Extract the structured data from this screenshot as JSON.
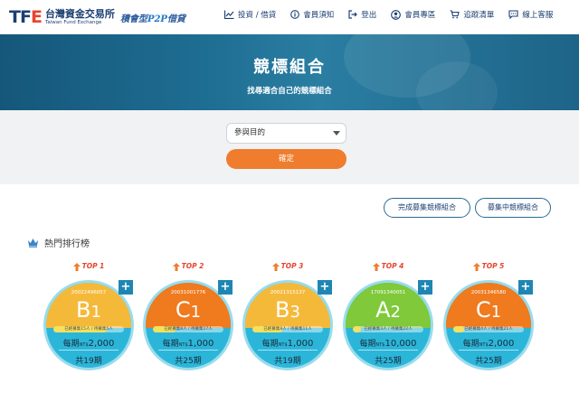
{
  "brand": {
    "mark_prefix": "TF",
    "mark_suffix": "E",
    "name_zh": "台灣資金交易所",
    "name_en": "Taiwan Fund Exchange",
    "slogan_a": "積會型",
    "slogan_p2p": "P2P",
    "slogan_b": "借貸"
  },
  "nav": [
    {
      "label": "投資 / 借貸",
      "icon": "chart-icon"
    },
    {
      "label": "會員須知",
      "icon": "info-icon"
    },
    {
      "label": "登出",
      "icon": "logout-icon"
    },
    {
      "label": "會員專區",
      "icon": "user-icon"
    },
    {
      "label": "追蹤清單",
      "icon": "cart-icon"
    },
    {
      "label": "線上客服",
      "icon": "chat-icon"
    }
  ],
  "banner": {
    "title": "競標組合",
    "subtitle": "找尋適合自己的競標組合"
  },
  "filter": {
    "select_value": "參與目的",
    "confirm_label": "確定"
  },
  "buttons": {
    "completed": "完成募集競標組合",
    "raising": "募集中競標組合"
  },
  "hot": {
    "title": "熱門排行榜",
    "icon": "crown-icon",
    "cards": [
      {
        "rank": "TOP 1",
        "id": "20022496057",
        "grade_letter": "B",
        "grade_num": "1",
        "bar_text": "已經募集15人 / 待募集5人",
        "progress": 0.75,
        "amount_prefix": "每期",
        "currency": "NT$",
        "amount": "2,000",
        "periods": "共19期",
        "color": "#f5b93a"
      },
      {
        "rank": "TOP 2",
        "id": "20031001776",
        "grade_letter": "C",
        "grade_num": "1",
        "bar_text": "已經募集8人 / 待募集17人",
        "progress": 0.32,
        "amount_prefix": "每期",
        "currency": "NT$",
        "amount": "1,000",
        "periods": "共25期",
        "color": "#f07a1e"
      },
      {
        "rank": "TOP 3",
        "id": "20021315137",
        "grade_letter": "B",
        "grade_num": "3",
        "bar_text": "已經募集8人 / 待募集11人",
        "progress": 0.42,
        "amount_prefix": "每期",
        "currency": "NT$",
        "amount": "1,000",
        "periods": "共19期",
        "color": "#f5b93a"
      },
      {
        "rank": "TOP 4",
        "id": "17091340051",
        "grade_letter": "A",
        "grade_num": "2",
        "bar_text": "已經募集3人 / 待募集22人",
        "progress": 0.12,
        "amount_prefix": "每期",
        "currency": "NT$",
        "amount": "10,000",
        "periods": "共25期",
        "color": "#7fc93a"
      },
      {
        "rank": "TOP 5",
        "id": "20031346580",
        "grade_letter": "C",
        "grade_num": "1",
        "bar_text": "已經募集4人 / 待募集21人",
        "progress": 0.16,
        "amount_prefix": "每期",
        "currency": "NT$",
        "amount": "2,000",
        "periods": "共25期",
        "color": "#f07a1e"
      }
    ]
  }
}
